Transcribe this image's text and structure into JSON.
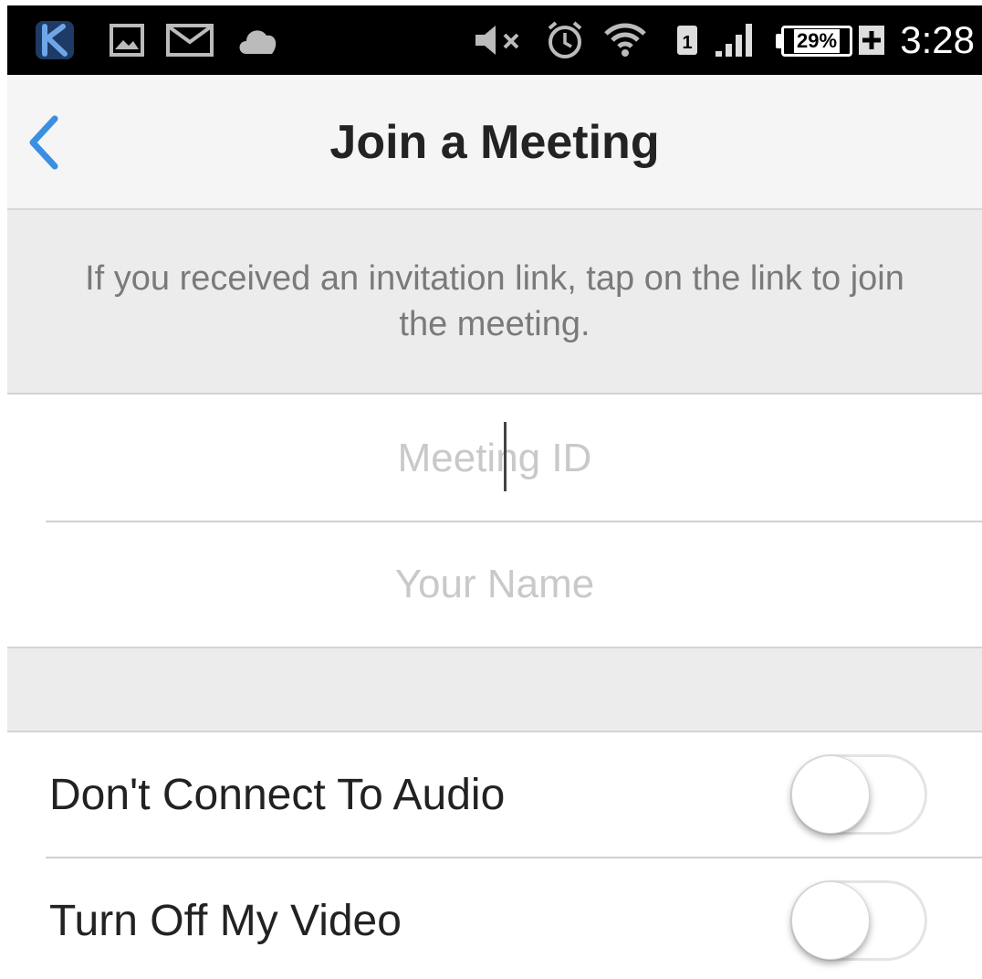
{
  "status_bar": {
    "time": "3:28",
    "battery_percent": "29%",
    "icons": [
      "k-app-icon",
      "image-icon",
      "mail-icon",
      "cloud-icon",
      "mute-icon",
      "alarm-icon",
      "wifi-icon",
      "sim-icon",
      "signal-icon",
      "battery-icon",
      "charging-icon"
    ]
  },
  "nav": {
    "title": "Join a Meeting",
    "back_icon": "chevron-left-icon"
  },
  "info": {
    "text": "If you received an invitation link, tap on the link to join the meeting."
  },
  "form": {
    "meeting_id": {
      "placeholder": "Meeting ID",
      "value": ""
    },
    "your_name": {
      "placeholder": "Your Name",
      "value": ""
    }
  },
  "options": {
    "audio": {
      "label": "Don't Connect To Audio",
      "enabled": false
    },
    "video": {
      "label": "Turn Off My Video",
      "enabled": false
    }
  },
  "colors": {
    "accent": "#3b8fe0",
    "status_bar_bg": "#000000",
    "nav_bg": "#f5f5f5",
    "banner_bg": "#ececec"
  }
}
